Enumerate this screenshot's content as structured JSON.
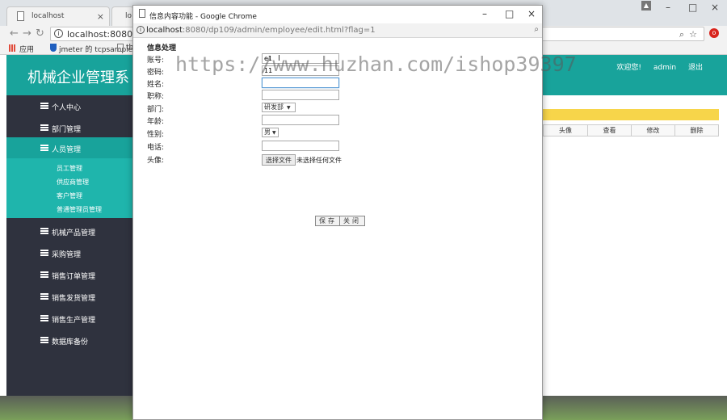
{
  "background_browser": {
    "tabs": [
      {
        "label": "localhost"
      },
      {
        "label": "lo"
      }
    ],
    "omnibox_url": "localhost:8080/dp1",
    "bookmarks": [
      {
        "label": "应用"
      },
      {
        "label": "jmeter 的 tcpsample"
      },
      {
        "label": "th"
      }
    ]
  },
  "admin": {
    "site_title": "机械企业管理系",
    "header_links": {
      "welcome": "欢迎您!",
      "user": "admin",
      "logout": "退出"
    },
    "sidebar": [
      {
        "label": "个人中心"
      },
      {
        "label": "部门管理"
      },
      {
        "label": "人员管理",
        "active": true
      },
      {
        "label": "机械产品管理"
      },
      {
        "label": "采购管理"
      },
      {
        "label": "销售订单管理"
      },
      {
        "label": "销售发货管理"
      },
      {
        "label": "销售生产管理"
      },
      {
        "label": "数据库备份"
      }
    ],
    "submenu": [
      {
        "label": "员工管理"
      },
      {
        "label": "供应商管理"
      },
      {
        "label": "客户管理"
      },
      {
        "label": "普通管理员管理"
      }
    ],
    "table_headers": [
      "头像",
      "查看",
      "修改",
      "删除"
    ]
  },
  "popup": {
    "window_title": "信息内容功能 - Google Chrome",
    "url_host": "localhost",
    "url_path": ":8080/dp109/admin/employee/edit.html?flag=1",
    "form_title": "信息处理",
    "fields": {
      "account": {
        "label": "账号:",
        "value": "e1"
      },
      "password": {
        "label": "密码:",
        "value": "11"
      },
      "name": {
        "label": "姓名:",
        "value": ""
      },
      "title": {
        "label": "职称:",
        "value": ""
      },
      "department": {
        "label": "部门:",
        "value": "研发部"
      },
      "age": {
        "label": "年龄:",
        "value": ""
      },
      "gender": {
        "label": "性别:",
        "value": "男"
      },
      "phone": {
        "label": "电话:",
        "value": ""
      },
      "avatar": {
        "label": "头像:",
        "button": "选择文件",
        "status": "未选择任何文件"
      }
    },
    "buttons": {
      "save": "保存",
      "close": "关闭"
    }
  },
  "watermark": "https://www.huzhan.com/ishop39397",
  "colors": {
    "accent": "#18a39b",
    "sidebar_bg": "#2f323e",
    "highlight": "#f7d54a"
  }
}
